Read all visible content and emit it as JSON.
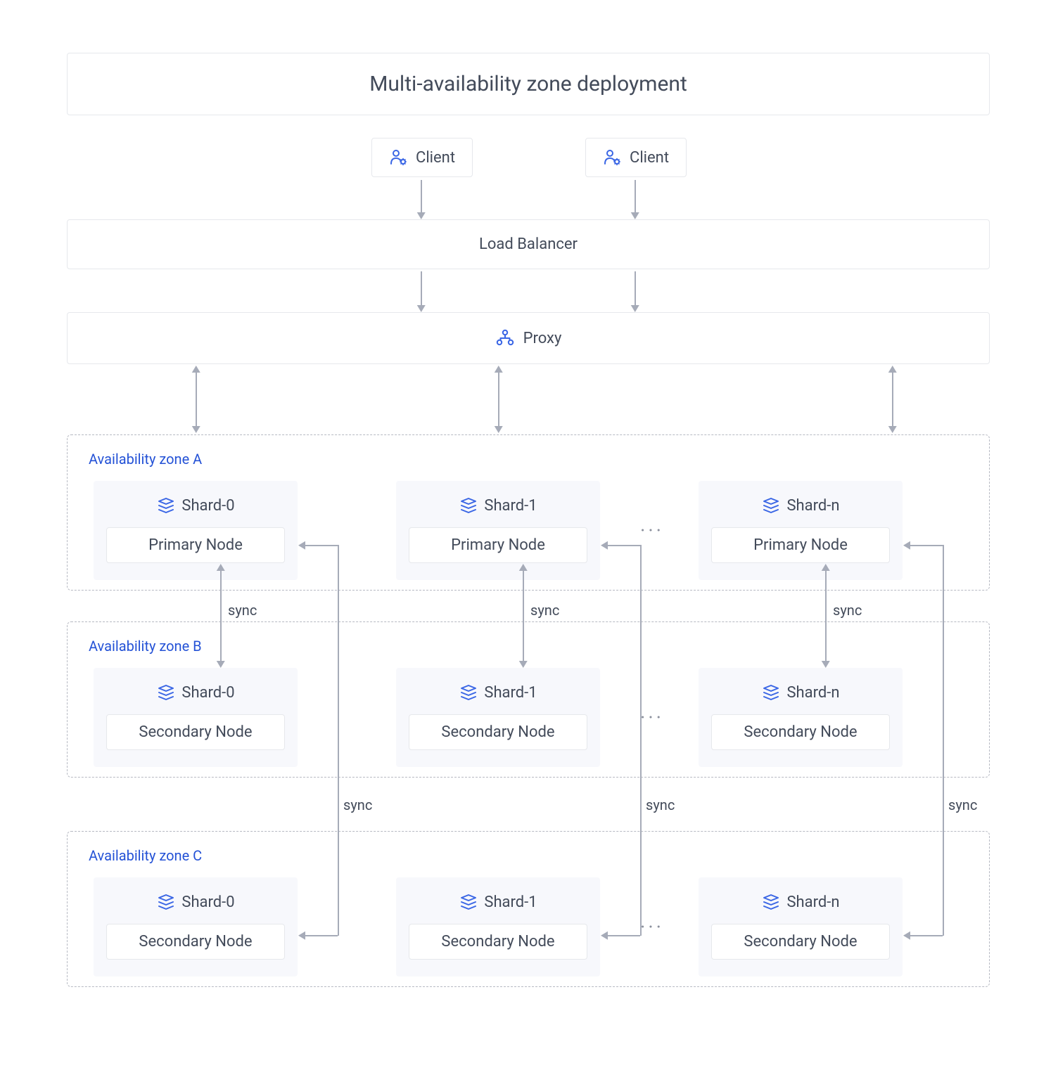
{
  "title": "Multi-availability zone deployment",
  "client_label": "Client",
  "load_balancer_label": "Load Balancer",
  "proxy_label": "Proxy",
  "ellipsis": "···",
  "sync_label": "sync",
  "zones": {
    "a": {
      "label": "Availability zone A",
      "role": "Primary Node"
    },
    "b": {
      "label": "Availability zone B",
      "role": "Secondary Node"
    },
    "c": {
      "label": "Availability zone C",
      "role": "Secondary Node"
    }
  },
  "shards": {
    "s0": "Shard-0",
    "s1": "Shard-1",
    "sn": "Shard-n"
  }
}
